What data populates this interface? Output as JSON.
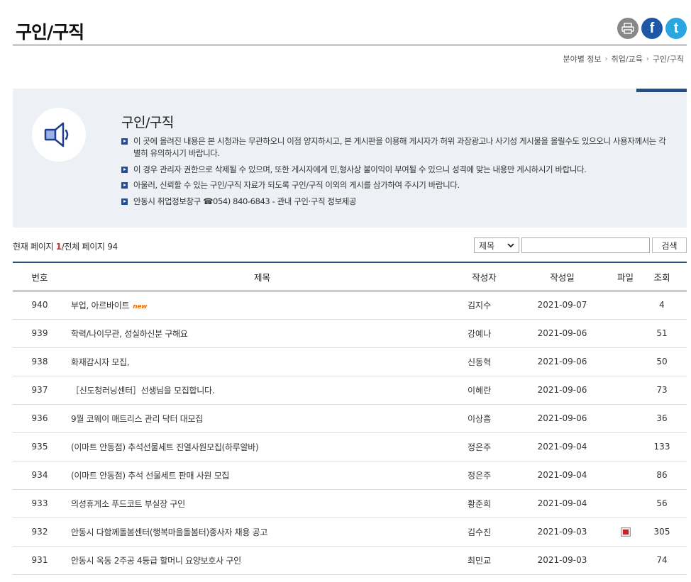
{
  "page": {
    "title": "구인/구직"
  },
  "share": {
    "print_icon": "printer-icon",
    "facebook_label": "f",
    "twitter_label": "t"
  },
  "breadcrumb": [
    "분야별 정보",
    "취업/교육",
    "구인/구직"
  ],
  "notice": {
    "title": "구인/구직",
    "items": [
      "이 곳에 올려진 내용은 본 시청과는 무관하오니 이점 양지하시고, 본 게시판을 이용해 게시자가 허위 과장광고나 사기성 게시물을 올릴수도 있으오니 사용자께서는 각별히 유의하시기 바랍니다.",
      "이 경우 관리자 권한으로 삭제될 수 있으며, 또한 게시자에게 민,형사상 불이익이 부여될 수 있으니 성격에 맞는 내용만 게시하시기 바랍니다.",
      "아울러, 신뢰할 수 있는 구인/구직 자료가 되도록 구인/구직 이외의 게시를 삼가하여 주시기 바랍니다.",
      "안동시 취업정보창구 ☎054) 840-6843 - 관내 구인·구직 정보제공"
    ]
  },
  "pageinfo": {
    "prefix": "현재 페이지",
    "current": "1",
    "sep": "/",
    "total_label": "전체 페이지",
    "total": "94"
  },
  "search": {
    "select_value": "제목",
    "input_value": "",
    "button_label": "검색"
  },
  "table": {
    "headers": {
      "no": "번호",
      "title": "제목",
      "author": "작성자",
      "date": "작성일",
      "file": "파일",
      "views": "조회"
    },
    "rows": [
      {
        "no": "940",
        "title": "부업, 아르바이트",
        "new": "new",
        "author": "김지수",
        "date": "2021-09-07",
        "file": false,
        "views": "4"
      },
      {
        "no": "939",
        "title": "학력/나이무관, 성실하신분 구해요",
        "author": "강예나",
        "date": "2021-09-06",
        "file": false,
        "views": "51"
      },
      {
        "no": "938",
        "title": "화재감시자 모집,",
        "author": "신동혁",
        "date": "2021-09-06",
        "file": false,
        "views": "50"
      },
      {
        "no": "937",
        "title": "［신도청러닝센터］선생님을 모집합니다.",
        "author": "이혜란",
        "date": "2021-09-06",
        "file": false,
        "views": "73"
      },
      {
        "no": "936",
        "title": "9월 코웨이 매트리스 관리 닥터 대모집",
        "author": "이상흠",
        "date": "2021-09-06",
        "file": false,
        "views": "36"
      },
      {
        "no": "935",
        "title": "(이마트 안동점) 추석선물세트 진열사원모집(하루알바)",
        "author": "정은주",
        "date": "2021-09-04",
        "file": false,
        "views": "133"
      },
      {
        "no": "934",
        "title": "(이마트 안동점) 추석 선물세트 판매 사원 모집",
        "author": "정은주",
        "date": "2021-09-04",
        "file": false,
        "views": "86"
      },
      {
        "no": "933",
        "title": "의성휴게소 푸드코트 부실장 구인",
        "author": "황준희",
        "date": "2021-09-04",
        "file": false,
        "views": "56"
      },
      {
        "no": "932",
        "title": "안동시 다함께돌봄센터(행복마을돌봄터)종사자 채용 공고",
        "author": "김수진",
        "date": "2021-09-03",
        "file": true,
        "views": "305"
      },
      {
        "no": "931",
        "title": "안동시 옥동 2주공 4등급 할머니 요양보호사 구인",
        "author": "최민교",
        "date": "2021-09-03",
        "file": false,
        "views": "74"
      }
    ]
  }
}
